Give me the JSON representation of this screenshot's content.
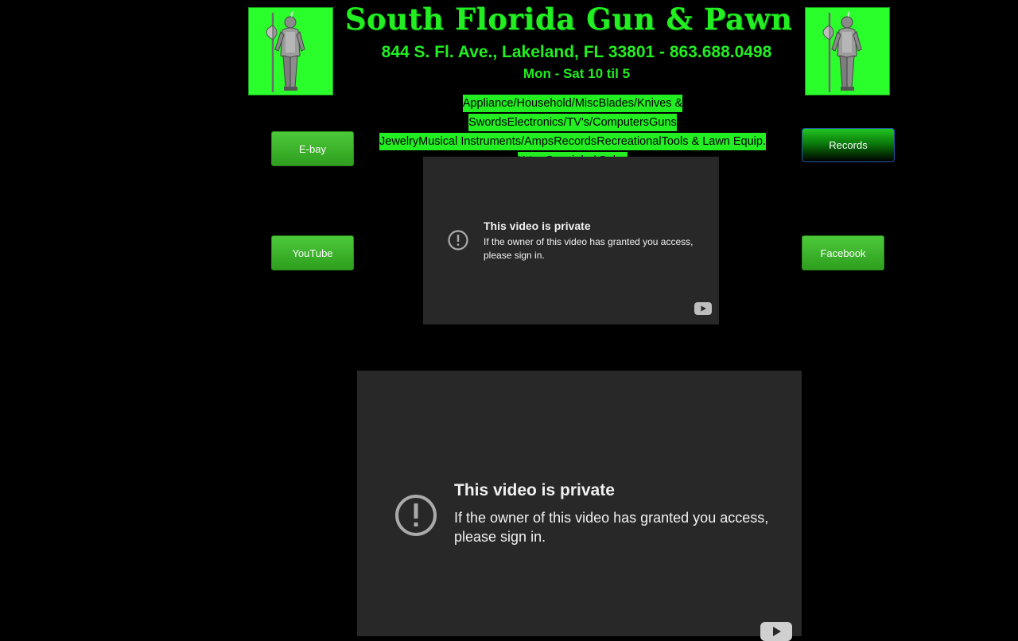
{
  "header": {
    "title": "South Florida Gun & Pawn",
    "address": "844 S. Fl. Ave., Lakeland, FL 33801 - 863.688.0498",
    "hours": "Mon - Sat 10 til 5"
  },
  "nav": {
    "line1": [
      "Appliance/Household/Misc",
      "Blades/Knives & Swords",
      "Electronics/TV's/Computers",
      "Guns"
    ],
    "line2": [
      "Jewelry",
      "Musical Instruments/Amps",
      "Records",
      "Recreational",
      "Tools & Lawn Equip."
    ],
    "line3": [
      "X-tra Specials / Sales"
    ]
  },
  "buttons": {
    "ebay": "E-bay",
    "youtube": "YouTube",
    "records": "Records",
    "facebook": "Facebook"
  },
  "video_small": {
    "title": "This video is private",
    "body": "If the owner of this video has granted you access, please sign in."
  },
  "video_large": {
    "title": "This video is private",
    "body": "If the owner of this video has granted you access, please sign in."
  },
  "colors": {
    "background": "#000000",
    "accent_green": "#22ee22",
    "video_bg": "#282828"
  }
}
